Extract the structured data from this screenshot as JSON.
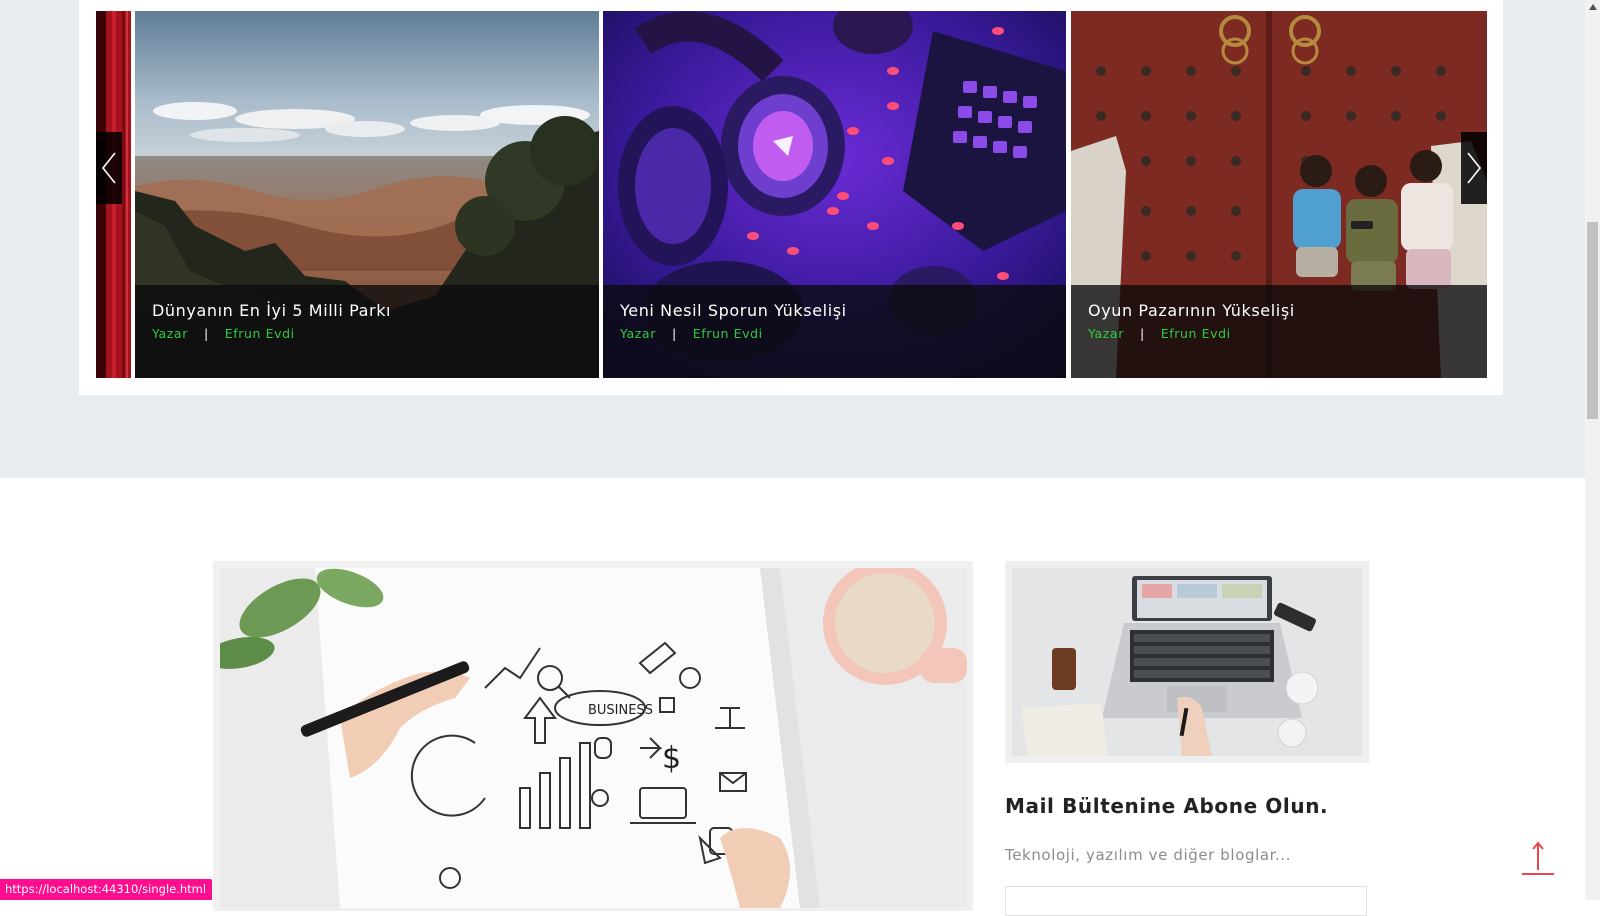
{
  "slider": {
    "slides": [
      {
        "title": "Dünyanın En İyi 5 Milli Parkı",
        "author_label": "Yazar",
        "author": "Efrun Evdi",
        "image": "grand-canyon-landscape"
      },
      {
        "title": "Yeni Nesil Sporun Yükselişi",
        "author_label": "Yazar",
        "author": "Efrun Evdi",
        "image": "gaming-headset-neon"
      },
      {
        "title": "Oyun Pazarının Yükselişi",
        "author_label": "Yazar",
        "author": "Efrun Evdi",
        "image": "kids-playing-phones"
      }
    ],
    "prev_icon": "chevron-left-icon",
    "next_icon": "chevron-right-icon",
    "meta_separator": "|"
  },
  "main": {
    "featured_image": "business-sketch-notebook"
  },
  "sidebar": {
    "image": "laptop-desk-top-view",
    "newsletter_title": "Mail Bültenine Abone Olun.",
    "newsletter_subtitle": "Teknoloji, yazılım ve diğer bloglar...",
    "email_value": "",
    "email_placeholder": ""
  },
  "back_to_top_icon": "arrow-up-icon",
  "status_bar": {
    "url": "https://localhost:44310/single.html"
  },
  "colors": {
    "accent_green": "#2ecc40",
    "band_bg": "#e9edf1",
    "back_to_top": "#e8474f",
    "status_bar_bg": "#ff0d8f"
  }
}
